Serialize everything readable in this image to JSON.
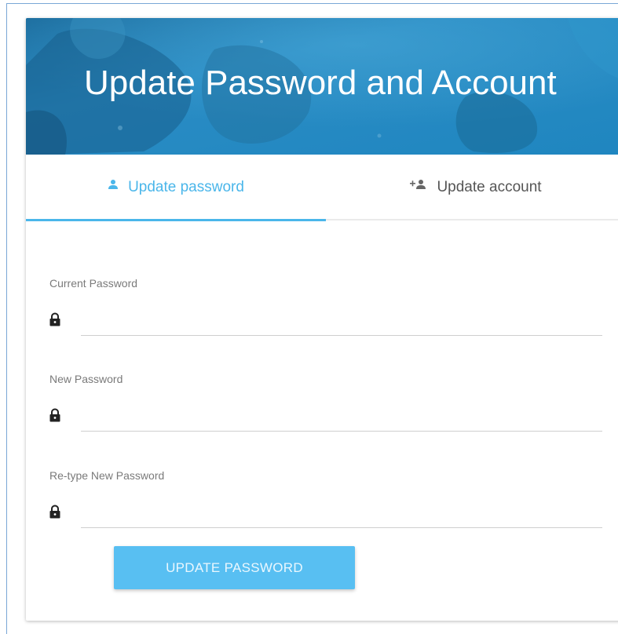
{
  "header": {
    "title": "Update Password and Account"
  },
  "tabs": {
    "password": {
      "label": "Update password",
      "icon": "person-icon",
      "active": true
    },
    "account": {
      "label": "Update account",
      "icon": "person-add-icon",
      "active": false
    }
  },
  "form": {
    "current_password": {
      "label": "Current Password",
      "value": "",
      "icon": "lock-icon"
    },
    "new_password": {
      "label": "New Password",
      "value": "",
      "icon": "lock-icon"
    },
    "retype_password": {
      "label": "Re-type New Password",
      "value": "",
      "icon": "lock-icon"
    },
    "submit_label": "UPDATE PASSWORD"
  },
  "colors": {
    "accent": "#4ab6ea",
    "button": "#58bff2",
    "banner": "#2488bd"
  }
}
